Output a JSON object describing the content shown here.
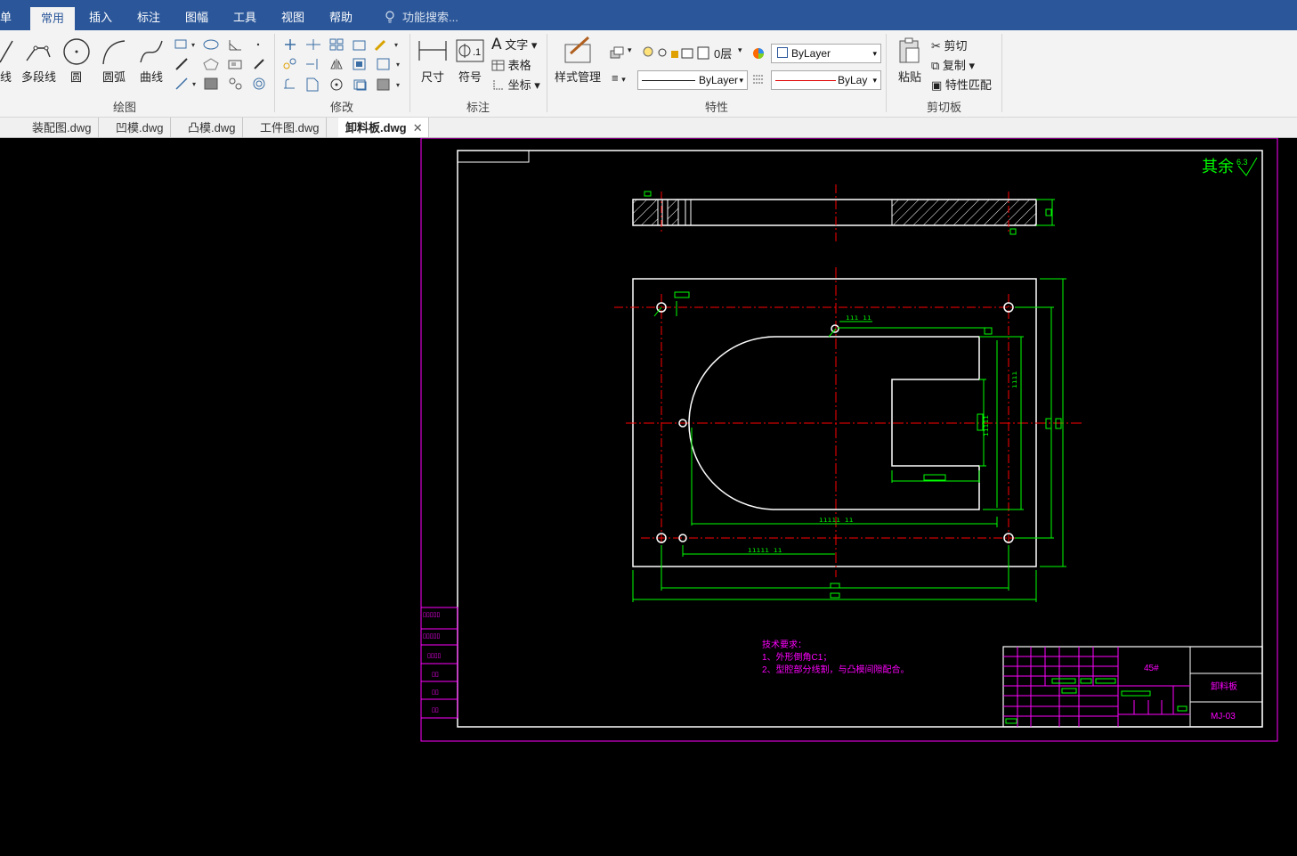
{
  "menubar": {
    "items": [
      "单",
      "常用",
      "插入",
      "标注",
      "图幅",
      "工具",
      "视图",
      "帮助"
    ],
    "active": "常用",
    "search_placeholder": "功能搜索..."
  },
  "ribbon": {
    "draw": {
      "label": "绘图",
      "line": "线",
      "polyline": "多段线",
      "circle": "圆",
      "arc": "圆弧",
      "curve": "曲线"
    },
    "modify": {
      "label": "修改"
    },
    "annotate": {
      "label": "标注",
      "dimension": "尺寸",
      "symbol": "符号",
      "text": "文字",
      "table": "表格",
      "coord": "坐标"
    },
    "properties": {
      "label": "特性",
      "style_manager": "样式管理",
      "layer": "0层",
      "color": "ByLayer",
      "linetype": "ByLayer",
      "lineweight": "ByLay"
    },
    "clipboard": {
      "label": "剪切板",
      "paste": "粘贴",
      "cut": "剪切",
      "copy": "复制",
      "match": "特性匹配"
    }
  },
  "doc_tabs": [
    "装配图.dwg",
    "凹模.dwg",
    "凸模.dwg",
    "工件图.dwg",
    "卸料板.dwg"
  ],
  "active_tab": "卸料板.dwg",
  "drawing": {
    "roughness": "其余",
    "roughness_value": "6.3",
    "tech_title": "技术要求：",
    "tech_1": "1、外形倒角C1；",
    "tech_2": "2、型腔部分线割，与凸模间隙配合。",
    "material": "45#",
    "part_name": "卸料板",
    "drawing_no": "MJ-03"
  },
  "colors": {
    "accent": "#2b579a",
    "frame": "#ffffff",
    "dimension": "#00ff00",
    "center": "#ff0000",
    "border": "#ff00ff"
  }
}
